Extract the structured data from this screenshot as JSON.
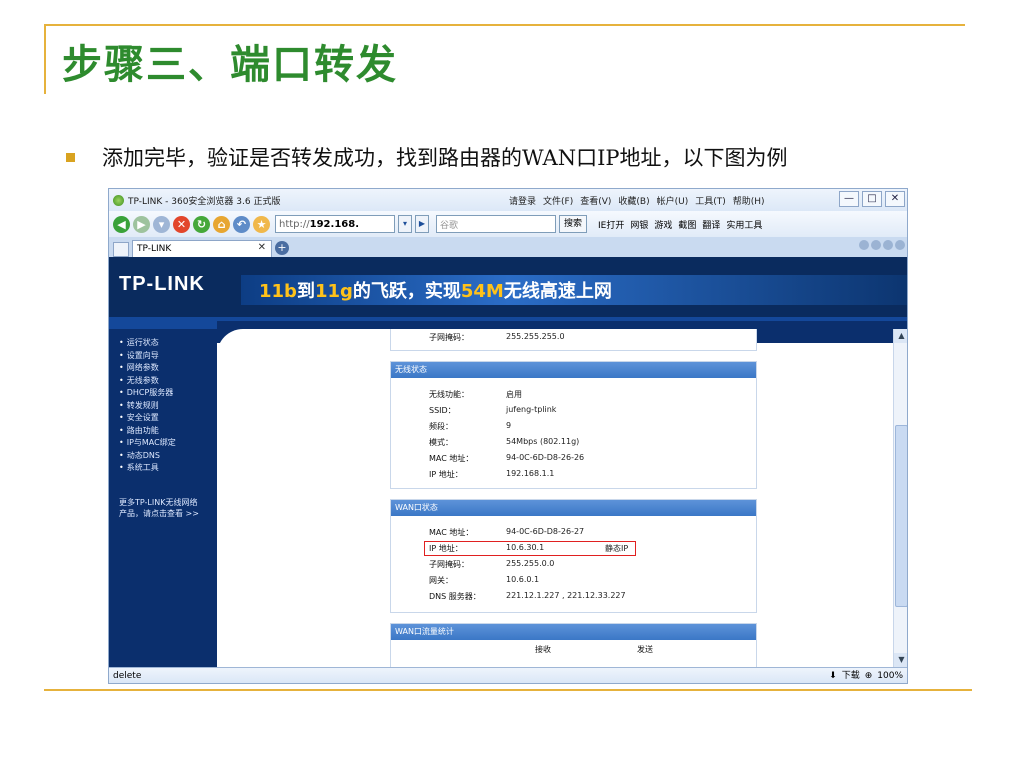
{
  "slide": {
    "title": "步骤三、端口转发",
    "bullet": "添加完毕，验证是否转发成功，找到路由器的WAN口IP地址，以下图为例"
  },
  "browser": {
    "title": "TP-LINK - 360安全浏览器 3.6 正式版",
    "menus": [
      "请登录",
      "文件(F)",
      "查看(V)",
      "收藏(B)",
      "帐户(U)",
      "工具(T)",
      "帮助(H)"
    ],
    "controls": [
      "—",
      "□",
      "✕"
    ],
    "url_scheme": "http://",
    "url_host": "192.168.",
    "search_placeholder": "谷歌",
    "search_button": "搜索",
    "toolbar_links": [
      "IE打开",
      "网银",
      "游戏",
      "截图",
      "翻译",
      "实用工具"
    ],
    "tab_title": "TP-LINK",
    "tab_close": "✕",
    "tab_new": "+",
    "status_left": "delete",
    "status_right": [
      "下载",
      "100%"
    ]
  },
  "router": {
    "logo": "TP-LINK",
    "slogan_parts": [
      "11b",
      "到",
      "11g",
      "的飞跃，实现",
      "54M",
      "无线高速上网"
    ],
    "sidebar": [
      "运行状态",
      "设置向导",
      "网络参数",
      "无线参数",
      "DHCP服务器",
      "转发规则",
      "安全设置",
      "路由功能",
      "IP与MAC绑定",
      "动态DNS",
      "系统工具"
    ],
    "sidebar_more_1": "更多TP-LINK无线网络",
    "sidebar_more_2": "产品，请点击查看 >>",
    "lan_tail": {
      "label": "子网掩码：",
      "value": "255.255.255.0"
    },
    "wireless": {
      "head": "无线状态",
      "rows": [
        {
          "label": "无线功能：",
          "value": "启用"
        },
        {
          "label": "SSID：",
          "value": "jufeng-tplink"
        },
        {
          "label": "频段：",
          "value": "9"
        },
        {
          "label": "模式：",
          "value": "54Mbps (802.11g)"
        },
        {
          "label": "MAC 地址：",
          "value": "94-0C-6D-D8-26-26"
        },
        {
          "label": "IP 地址：",
          "value": "192.168.1.1"
        }
      ]
    },
    "wan": {
      "head": "WAN口状态",
      "rows": [
        {
          "label": "MAC 地址：",
          "value": "94-0C-6D-D8-26-27",
          "note": ""
        },
        {
          "label": "IP 地址：",
          "value": "10.6.30.1",
          "note": "静态IP"
        },
        {
          "label": "子网掩码：",
          "value": "255.255.0.0",
          "note": ""
        },
        {
          "label": "网关：",
          "value": "10.6.0.1",
          "note": ""
        },
        {
          "label": "DNS 服务器：",
          "value": "221.12.1.227 , 221.12.33.227",
          "note": ""
        }
      ]
    },
    "traffic": {
      "head": "WAN口流量统计",
      "col_recv": "接收",
      "col_send": "发送"
    }
  },
  "colors": {
    "slide_title": "#2e8b2e",
    "accent_line": "#e6b23c",
    "router_navy": "#0b2f6d",
    "highlight_box": "#e02020"
  }
}
